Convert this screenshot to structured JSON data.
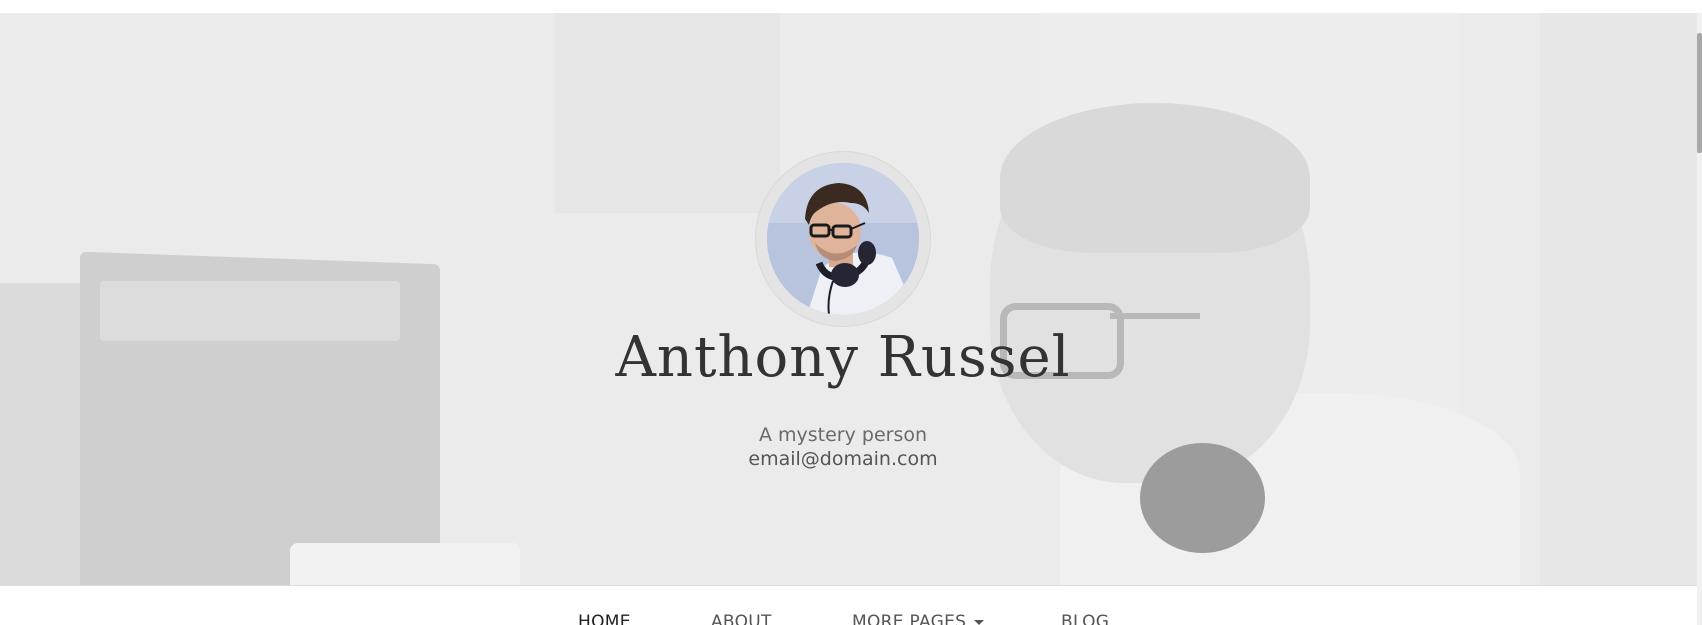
{
  "profile": {
    "name": "Anthony Russel",
    "tagline": "A mystery person",
    "email": "email@domain.com"
  },
  "nav": {
    "items": [
      {
        "label": "HOME",
        "active": true
      },
      {
        "label": "ABOUT",
        "active": false
      },
      {
        "label": "MORE PAGES",
        "active": false,
        "has_dropdown": true
      },
      {
        "label": "BLOG",
        "active": false
      }
    ]
  },
  "icons": {
    "dropdown": "caret-down-icon"
  },
  "colors": {
    "hero_bg": "#e9e9e9",
    "name_text": "#333333",
    "tagline_text": "#6a6a6a",
    "nav_text": "#555555"
  }
}
